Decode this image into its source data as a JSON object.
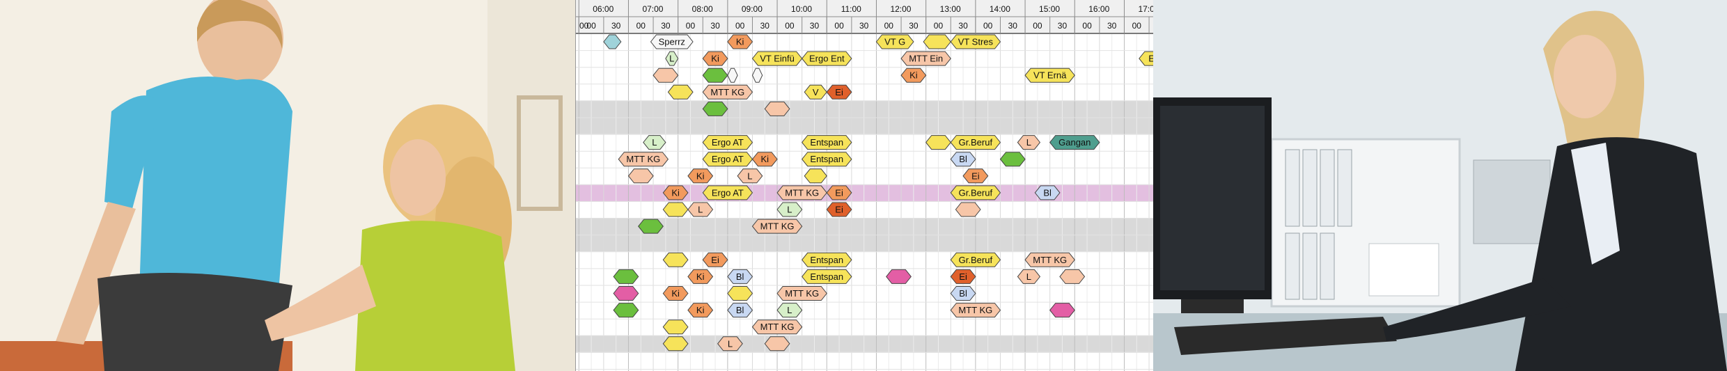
{
  "timeline": {
    "hours": [
      "06:00",
      "07:00",
      "08:00",
      "09:00",
      "10:00",
      "11:00",
      "12:00",
      "13:00",
      "14:00",
      "15:00",
      "16:00",
      "17:00"
    ],
    "minute_marks": [
      "00",
      "30"
    ]
  },
  "colors": {
    "yellow": "#f6e35a",
    "orange": "#f29a5d",
    "salmon": "#f7c6a8",
    "green": "#6bbf3e",
    "light_green": "#d7efc9",
    "blue": "#c8d8f2",
    "teal": "#4f9e8e",
    "pink": "#e35ea5",
    "red": "#e0602b",
    "sky": "#9fd3da",
    "white": "#f7f7f7",
    "row_gray": "#d9d9d9",
    "row_pink": "#e3bfe0"
  },
  "shaded_rows": [
    {
      "row": 5,
      "style": "gray"
    },
    {
      "row": 6,
      "style": "gray"
    },
    {
      "row": 10,
      "style": "pink"
    },
    {
      "row": 12,
      "style": "gray"
    },
    {
      "row": 13,
      "style": "gray"
    },
    {
      "row": 19,
      "style": "gray"
    }
  ],
  "appointments": [
    {
      "row": 1,
      "start": 6.5,
      "end": 6.85,
      "label": "",
      "color": "sky"
    },
    {
      "row": 1,
      "start": 7.45,
      "end": 8.3,
      "label": "Sperrz",
      "color": "white"
    },
    {
      "row": 1,
      "start": 9.0,
      "end": 9.5,
      "label": "Ki",
      "color": "orange"
    },
    {
      "row": 1,
      "start": 12.0,
      "end": 12.75,
      "label": "VT G",
      "color": "yellow"
    },
    {
      "row": 1,
      "start": 12.95,
      "end": 13.5,
      "label": "",
      "color": "yellow"
    },
    {
      "row": 1,
      "start": 13.5,
      "end": 14.5,
      "label": "VT Stres",
      "color": "yellow"
    },
    {
      "row": 2,
      "start": 7.75,
      "end": 8.0,
      "label": "L",
      "color": "light_green"
    },
    {
      "row": 2,
      "start": 8.5,
      "end": 9.0,
      "label": "Ki",
      "color": "orange"
    },
    {
      "row": 2,
      "start": 9.5,
      "end": 10.5,
      "label": "VT Einfü",
      "color": "yellow"
    },
    {
      "row": 2,
      "start": 10.5,
      "end": 11.5,
      "label": "Ergo Ent",
      "color": "yellow"
    },
    {
      "row": 2,
      "start": 12.5,
      "end": 13.5,
      "label": "MTT Ein",
      "color": "salmon"
    },
    {
      "row": 2,
      "start": 17.3,
      "end": 17.8,
      "label": "E",
      "color": "yellow"
    },
    {
      "row": 3,
      "start": 7.5,
      "end": 8.0,
      "label": "",
      "color": "salmon"
    },
    {
      "row": 3,
      "start": 8.5,
      "end": 9.0,
      "label": "",
      "color": "green"
    },
    {
      "row": 3,
      "start": 9.0,
      "end": 9.2,
      "label": "",
      "color": "white"
    },
    {
      "row": 3,
      "start": 9.5,
      "end": 9.7,
      "label": "",
      "color": "white"
    },
    {
      "row": 3,
      "start": 12.5,
      "end": 13.0,
      "label": "Ki",
      "color": "orange"
    },
    {
      "row": 3,
      "start": 15.0,
      "end": 16.0,
      "label": "VT Ernä",
      "color": "yellow"
    },
    {
      "row": 4,
      "start": 7.8,
      "end": 8.3,
      "label": "",
      "color": "yellow"
    },
    {
      "row": 4,
      "start": 8.5,
      "end": 9.5,
      "label": "MTT KG",
      "color": "salmon"
    },
    {
      "row": 4,
      "start": 10.55,
      "end": 11.0,
      "label": "V",
      "color": "yellow"
    },
    {
      "row": 4,
      "start": 11.0,
      "end": 11.5,
      "label": "Ei",
      "color": "red"
    },
    {
      "row": 5,
      "start": 8.5,
      "end": 9.0,
      "label": "",
      "color": "green"
    },
    {
      "row": 5,
      "start": 9.75,
      "end": 10.25,
      "label": "",
      "color": "salmon"
    },
    {
      "row": 7,
      "start": 7.3,
      "end": 7.75,
      "label": "L",
      "color": "light_green"
    },
    {
      "row": 7,
      "start": 8.5,
      "end": 9.5,
      "label": "Ergo AT",
      "color": "yellow"
    },
    {
      "row": 7,
      "start": 10.5,
      "end": 11.5,
      "label": "Entspan",
      "color": "yellow"
    },
    {
      "row": 7,
      "start": 13.0,
      "end": 13.5,
      "label": "",
      "color": "yellow"
    },
    {
      "row": 7,
      "start": 13.5,
      "end": 14.5,
      "label": "Gr.Beruf",
      "color": "yellow"
    },
    {
      "row": 7,
      "start": 14.85,
      "end": 15.3,
      "label": "L",
      "color": "salmon"
    },
    {
      "row": 7,
      "start": 15.5,
      "end": 16.5,
      "label": "Gangan",
      "color": "teal"
    },
    {
      "row": 8,
      "start": 6.8,
      "end": 7.8,
      "label": "MTT KG",
      "color": "salmon"
    },
    {
      "row": 8,
      "start": 8.5,
      "end": 9.5,
      "label": "Ergo AT",
      "color": "yellow"
    },
    {
      "row": 8,
      "start": 9.5,
      "end": 10.0,
      "label": "Ki",
      "color": "orange"
    },
    {
      "row": 8,
      "start": 10.5,
      "end": 11.5,
      "label": "Entspan",
      "color": "yellow"
    },
    {
      "row": 8,
      "start": 13.5,
      "end": 14.0,
      "label": "Bl",
      "color": "blue"
    },
    {
      "row": 8,
      "start": 14.5,
      "end": 15.0,
      "label": "",
      "color": "green"
    },
    {
      "row": 9,
      "start": 7.0,
      "end": 7.5,
      "label": "",
      "color": "salmon"
    },
    {
      "row": 9,
      "start": 8.2,
      "end": 8.7,
      "label": "Ki",
      "color": "orange"
    },
    {
      "row": 9,
      "start": 9.2,
      "end": 9.7,
      "label": "L",
      "color": "salmon"
    },
    {
      "row": 9,
      "start": 10.55,
      "end": 11.0,
      "label": "",
      "color": "yellow"
    },
    {
      "row": 9,
      "start": 13.75,
      "end": 14.25,
      "label": "Ei",
      "color": "orange"
    },
    {
      "row": 10,
      "start": 7.7,
      "end": 8.2,
      "label": "Ki",
      "color": "orange"
    },
    {
      "row": 10,
      "start": 8.5,
      "end": 9.5,
      "label": "Ergo AT",
      "color": "yellow"
    },
    {
      "row": 10,
      "start": 10.0,
      "end": 11.0,
      "label": "MTT KG",
      "color": "salmon"
    },
    {
      "row": 10,
      "start": 11.0,
      "end": 11.5,
      "label": "Ei",
      "color": "orange"
    },
    {
      "row": 10,
      "start": 13.5,
      "end": 14.5,
      "label": "Gr.Beruf",
      "color": "yellow"
    },
    {
      "row": 10,
      "start": 15.2,
      "end": 15.7,
      "label": "Bl",
      "color": "blue"
    },
    {
      "row": 11,
      "start": 7.7,
      "end": 8.2,
      "label": "",
      "color": "yellow"
    },
    {
      "row": 11,
      "start": 8.2,
      "end": 8.7,
      "label": "L",
      "color": "salmon"
    },
    {
      "row": 11,
      "start": 10.0,
      "end": 10.5,
      "label": "L",
      "color": "light_green"
    },
    {
      "row": 11,
      "start": 11.0,
      "end": 11.5,
      "label": "Ei",
      "color": "red"
    },
    {
      "row": 11,
      "start": 13.6,
      "end": 14.1,
      "label": "",
      "color": "salmon"
    },
    {
      "row": 12,
      "start": 7.2,
      "end": 7.7,
      "label": "",
      "color": "green"
    },
    {
      "row": 12,
      "start": 9.5,
      "end": 10.5,
      "label": "MTT KG",
      "color": "salmon"
    },
    {
      "row": 14,
      "start": 7.7,
      "end": 8.2,
      "label": "",
      "color": "yellow"
    },
    {
      "row": 14,
      "start": 8.5,
      "end": 9.0,
      "label": "Ei",
      "color": "orange"
    },
    {
      "row": 14,
      "start": 10.5,
      "end": 11.5,
      "label": "Entspan",
      "color": "yellow"
    },
    {
      "row": 14,
      "start": 13.5,
      "end": 14.5,
      "label": "Gr.Beruf",
      "color": "yellow"
    },
    {
      "row": 14,
      "start": 15.0,
      "end": 16.0,
      "label": "MTT KG",
      "color": "salmon"
    },
    {
      "row": 15,
      "start": 6.7,
      "end": 7.2,
      "label": "",
      "color": "green"
    },
    {
      "row": 15,
      "start": 8.2,
      "end": 8.7,
      "label": "Ki",
      "color": "orange"
    },
    {
      "row": 15,
      "start": 9.0,
      "end": 9.5,
      "label": "Bl",
      "color": "blue"
    },
    {
      "row": 15,
      "start": 10.5,
      "end": 11.5,
      "label": "Entspan",
      "color": "yellow"
    },
    {
      "row": 15,
      "start": 12.2,
      "end": 12.7,
      "label": "",
      "color": "pink"
    },
    {
      "row": 15,
      "start": 13.5,
      "end": 14.0,
      "label": "Ei",
      "color": "red"
    },
    {
      "row": 15,
      "start": 14.85,
      "end": 15.3,
      "label": "L",
      "color": "salmon"
    },
    {
      "row": 15,
      "start": 15.7,
      "end": 16.2,
      "label": "",
      "color": "salmon"
    },
    {
      "row": 16,
      "start": 6.7,
      "end": 7.2,
      "label": "",
      "color": "pink"
    },
    {
      "row": 16,
      "start": 7.7,
      "end": 8.2,
      "label": "Ki",
      "color": "orange"
    },
    {
      "row": 16,
      "start": 9.0,
      "end": 9.5,
      "label": "",
      "color": "yellow"
    },
    {
      "row": 16,
      "start": 10.0,
      "end": 11.0,
      "label": "MTT KG",
      "color": "salmon"
    },
    {
      "row": 16,
      "start": 13.5,
      "end": 14.0,
      "label": "Bl",
      "color": "blue"
    },
    {
      "row": 17,
      "start": 6.7,
      "end": 7.2,
      "label": "",
      "color": "green"
    },
    {
      "row": 17,
      "start": 8.2,
      "end": 8.7,
      "label": "Ki",
      "color": "orange"
    },
    {
      "row": 17,
      "start": 9.0,
      "end": 9.5,
      "label": "Bl",
      "color": "blue"
    },
    {
      "row": 17,
      "start": 10.0,
      "end": 10.5,
      "label": "L",
      "color": "light_green"
    },
    {
      "row": 17,
      "start": 13.5,
      "end": 14.5,
      "label": "MTT KG",
      "color": "salmon"
    },
    {
      "row": 17,
      "start": 15.5,
      "end": 16.0,
      "label": "",
      "color": "pink"
    },
    {
      "row": 18,
      "start": 7.7,
      "end": 8.2,
      "label": "",
      "color": "yellow"
    },
    {
      "row": 18,
      "start": 9.5,
      "end": 10.5,
      "label": "MTT KG",
      "color": "salmon"
    },
    {
      "row": 19,
      "start": 7.7,
      "end": 8.2,
      "label": "",
      "color": "yellow"
    },
    {
      "row": 19,
      "start": 8.8,
      "end": 9.3,
      "label": "L",
      "color": "salmon"
    },
    {
      "row": 19,
      "start": 9.75,
      "end": 10.25,
      "label": "",
      "color": "salmon"
    }
  ]
}
